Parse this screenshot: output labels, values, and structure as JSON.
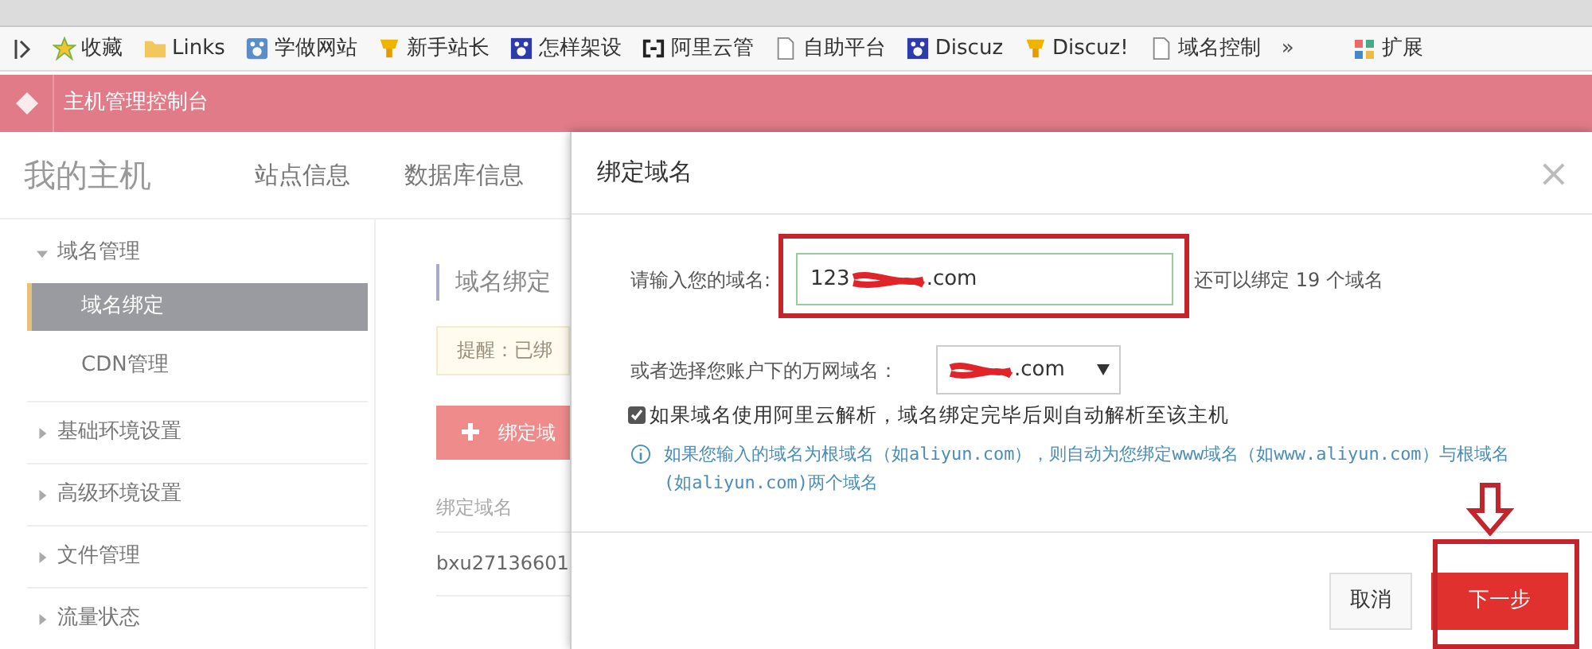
{
  "browser": {
    "bookmarks": [
      {
        "label": "收藏",
        "kind": "star"
      },
      {
        "label": "Links",
        "kind": "folder"
      },
      {
        "label": "学做网站",
        "kind": "badge"
      },
      {
        "label": "新手站长",
        "kind": "cup"
      },
      {
        "label": "怎样架设",
        "kind": "paw"
      },
      {
        "label": "阿里云管",
        "kind": "bracket"
      },
      {
        "label": "自助平台",
        "kind": "page"
      },
      {
        "label": "Discuz",
        "kind": "paw"
      },
      {
        "label": "Discuz!",
        "kind": "cup"
      },
      {
        "label": "域名控制",
        "kind": "page"
      }
    ],
    "overflow": "»",
    "extensions": "扩展"
  },
  "app_header": {
    "title": "主机管理控制台"
  },
  "host_nav": {
    "title": "我的主机",
    "tabs": [
      "站点信息",
      "数据库信息"
    ]
  },
  "sidebar": {
    "groups": [
      {
        "label": "域名管理",
        "expanded": true,
        "children": [
          {
            "label": "域名绑定",
            "selected": true
          },
          {
            "label": "CDN管理",
            "selected": false
          }
        ]
      },
      {
        "label": "基础环境设置",
        "expanded": false
      },
      {
        "label": "高级环境设置",
        "expanded": false
      },
      {
        "label": "文件管理",
        "expanded": false
      },
      {
        "label": "流量状态",
        "expanded": false
      }
    ]
  },
  "content": {
    "title": "域名绑定",
    "alert": "提醒：已绑",
    "add_button": "绑定域",
    "table": {
      "columns": [
        "绑定域名"
      ],
      "rows": [
        [
          "bxu27136601"
        ]
      ]
    }
  },
  "dialog": {
    "title": "绑定域名",
    "close": "×",
    "domain_label": "请输入您的域名:",
    "domain_value_start": "123",
    "domain_value_end": ".com",
    "quota": "还可以绑定 19 个域名",
    "select_label": "或者选择您账户下的万网域名：",
    "select_value_end": ".com",
    "auto_resolve": {
      "label": "如果域名使用阿里云解析，域名绑定完毕后则自动解析至该主机",
      "checked": true
    },
    "info": "如果您输入的域名为根域名（如aliyun.com），则自动为您绑定www域名（如www.aliyun.com）与根域名(如aliyun.com)两个域名",
    "buttons": {
      "cancel": "取消",
      "next": "下一步"
    }
  }
}
